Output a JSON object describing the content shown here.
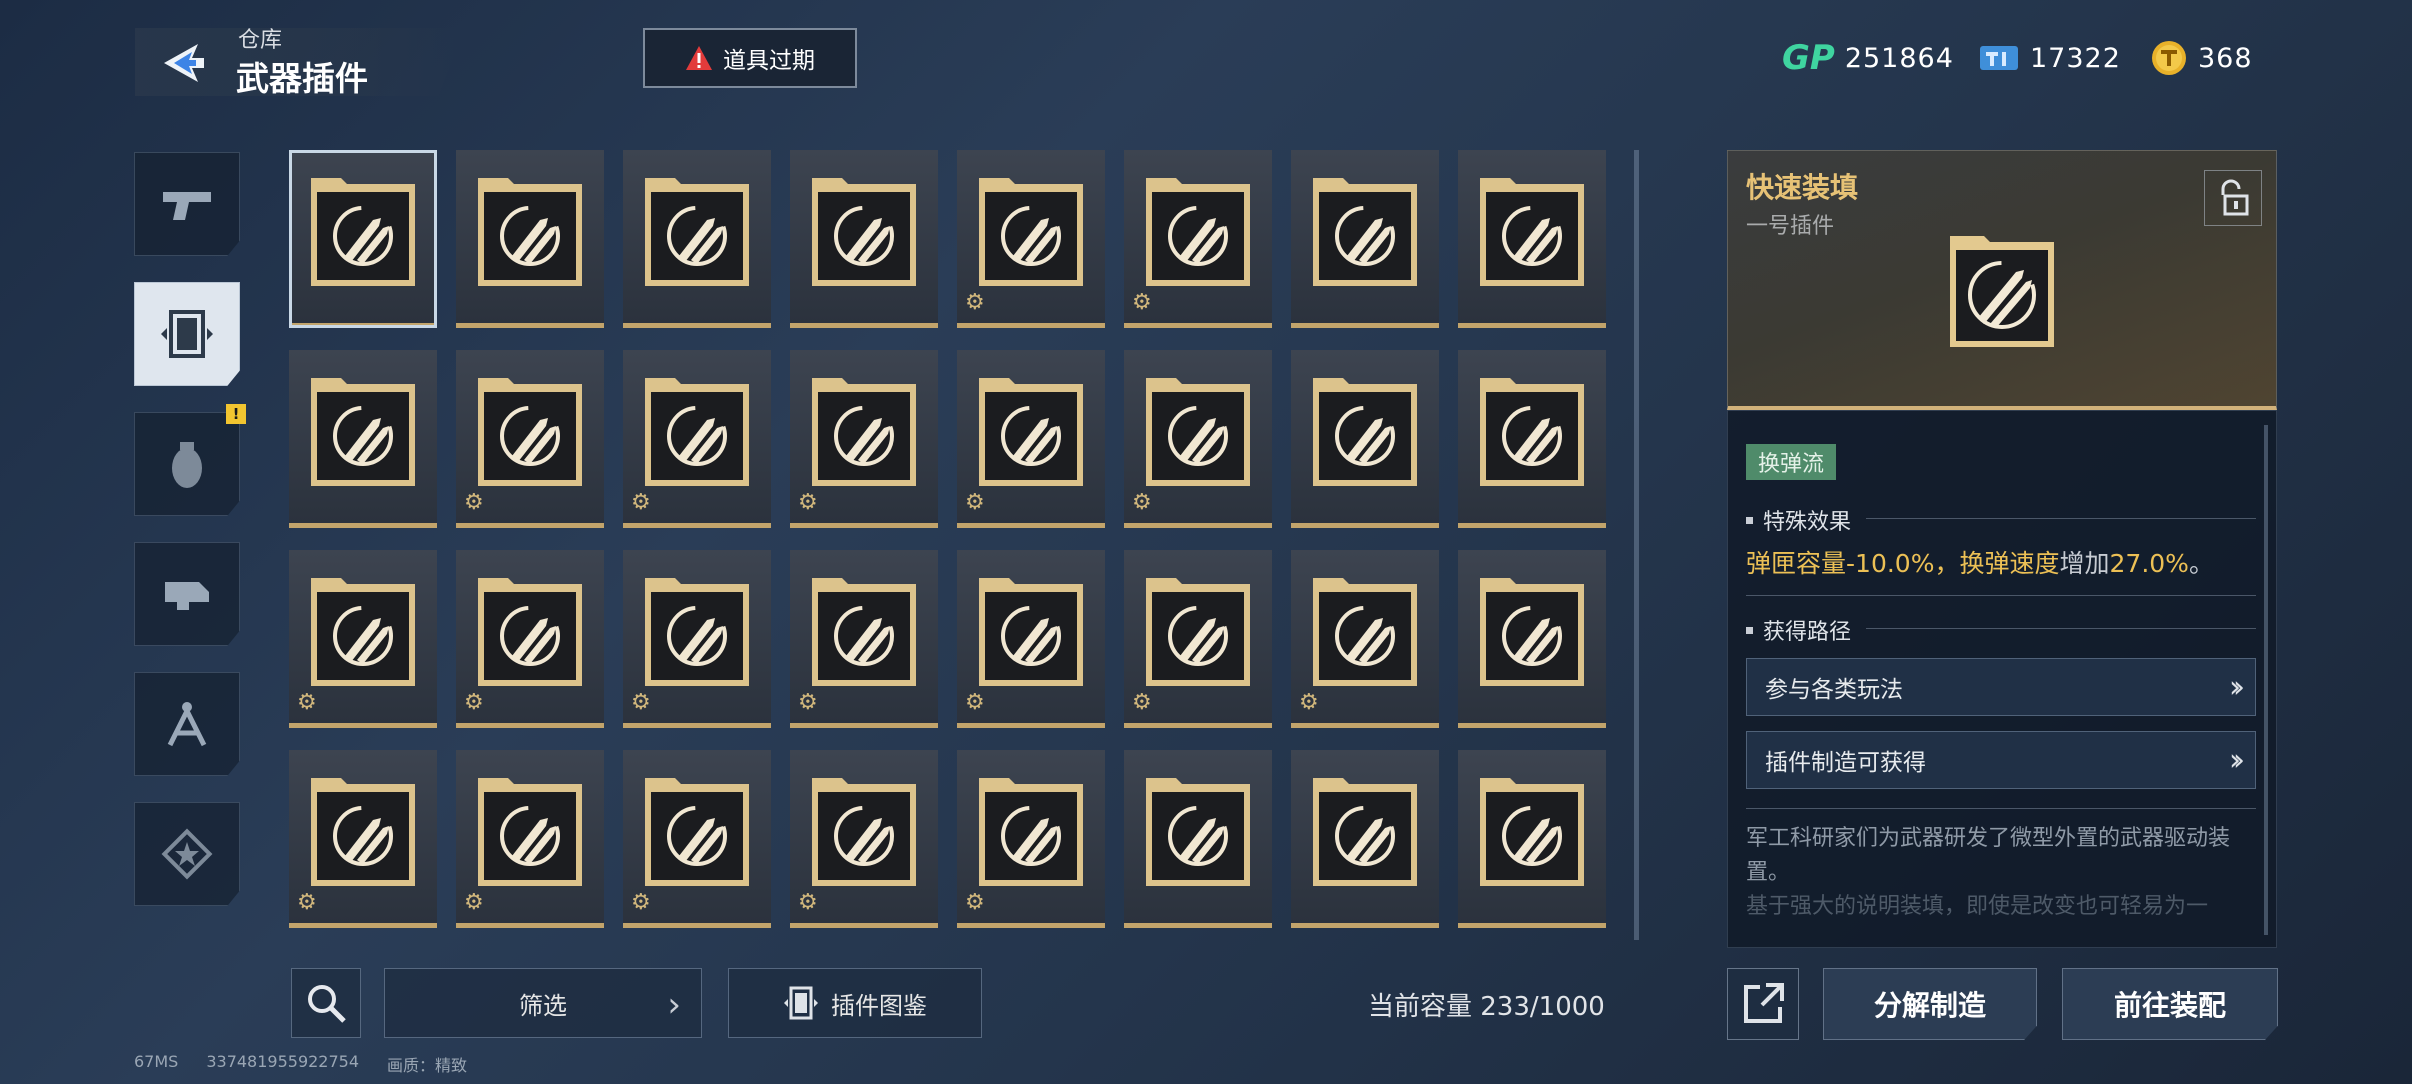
{
  "header": {
    "breadcrumb": "仓库",
    "title": "武器插件",
    "back_icon": "back-arrow-icon",
    "expire_label": "道具过期",
    "expire_color": "#e23b3b"
  },
  "currencies": [
    {
      "icon": "gp-icon",
      "prefix": "GP",
      "value": "251864"
    },
    {
      "icon": "ticket-icon",
      "value": "17322"
    },
    {
      "icon": "coin-icon",
      "value": "368"
    }
  ],
  "sidebar": {
    "tabs": [
      {
        "name": "weapon",
        "icon": "pistol-icon"
      },
      {
        "name": "plugin",
        "icon": "plugin-chip-icon",
        "active": true
      },
      {
        "name": "grenade",
        "icon": "grenade-icon"
      },
      {
        "name": "attachment",
        "icon": "attachment-icon"
      },
      {
        "name": "blueprint",
        "icon": "compass-icon"
      },
      {
        "name": "badge",
        "icon": "star-badge-icon"
      }
    ],
    "alert_badge": "!"
  },
  "grid": {
    "items": [
      {
        "icon": "rocket-reload-icon",
        "selected": true,
        "gear": false
      },
      {
        "icon": "rocket-reload-icon",
        "gear": false
      },
      {
        "icon": "target-head-ammo-icon",
        "gear": false
      },
      {
        "icon": "target-head-ammo-icon",
        "gear": false
      },
      {
        "icon": "ammo-warning-icon",
        "gear": true
      },
      {
        "icon": "crosshair-ammo-icon",
        "gear": true
      },
      {
        "icon": "double-bullet-icon",
        "gear": false
      },
      {
        "icon": "double-bullet-icon",
        "gear": false
      },
      {
        "icon": "double-bullet-icon",
        "gear": false
      },
      {
        "icon": "gun-ammo-icon",
        "gear": true
      },
      {
        "icon": "gun-ammo-icon",
        "gear": true
      },
      {
        "icon": "crossed-arrows-icon",
        "gear": true
      },
      {
        "icon": "up-arrow-target-icon",
        "gear": true
      },
      {
        "icon": "up-arrow-target-icon",
        "gear": true
      },
      {
        "icon": "magazine-up-icon",
        "gear": false
      },
      {
        "icon": "magazine-up-icon",
        "gear": false
      },
      {
        "icon": "triple-rocket-icon",
        "gear": true
      },
      {
        "icon": "triple-rocket-icon",
        "gear": true
      },
      {
        "icon": "bullets-splash-icon",
        "gear": true
      },
      {
        "icon": "magazine-stack-icon",
        "gear": true
      },
      {
        "icon": "hex-network-icon",
        "gear": true
      },
      {
        "icon": "warning-cycle-icon",
        "gear": true
      },
      {
        "icon": "warning-cycle-icon",
        "gear": true
      },
      {
        "icon": "bullet-cycle-icon",
        "gear": false
      },
      {
        "icon": "crossed-swords-icon",
        "gear": true
      },
      {
        "icon": "skull-cycle-icon",
        "gear": true
      },
      {
        "icon": "hex-bullet-icon",
        "gear": true
      },
      {
        "icon": "target-ammo-icon",
        "gear": true
      },
      {
        "icon": "target-ammo-icon",
        "gear": true
      },
      {
        "icon": "shatter-ammo-icon",
        "gear": false
      },
      {
        "icon": "shatter-ammo-icon",
        "gear": false
      },
      {
        "icon": "triangle-warning-icon",
        "gear": false
      }
    ]
  },
  "bottom": {
    "search_icon": "search-icon",
    "filter_label": "筛选",
    "codex_label": "插件图鉴",
    "capacity": "当前容量 233/1000"
  },
  "footer": {
    "ping": "67MS",
    "uid": "337481955922754",
    "quality": "画质：精致"
  },
  "detail": {
    "name": "快速装填",
    "subtitle": "一号插件",
    "tag": "换弹流",
    "effect_header": "特殊效果",
    "effect_parts": [
      "弹匣容量",
      "-10.0%",
      "，",
      "换弹速度",
      "增加",
      "27.0%",
      "。"
    ],
    "route_header": "获得路径",
    "routes": [
      "参与各类玩法",
      "插件制造可获得"
    ],
    "description": "军工科研家们为武器研发了微型外置的武器驱动装置。",
    "description_faded": "基于强大的说明装填，即使是改变也可轻易为一"
  },
  "actions": {
    "share_icon": "share-icon",
    "dismantle": "分解制造",
    "equip": "前往装配"
  }
}
